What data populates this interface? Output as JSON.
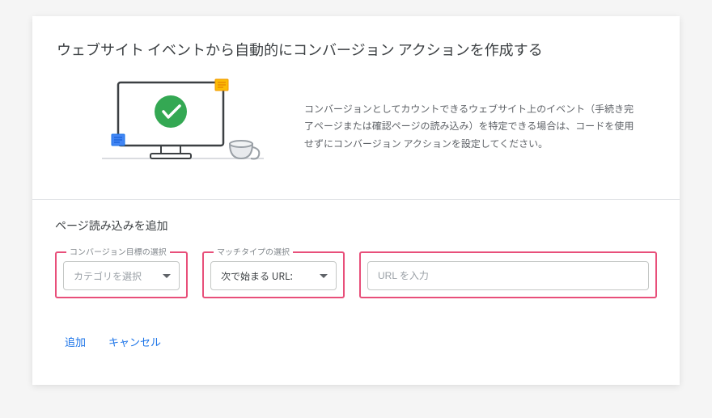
{
  "page": {
    "title": "ウェブサイト イベントから自動的にコンバージョン アクションを作成する",
    "hero_description": "コンバージョンとしてカウントできるウェブサイト上のイベント（手続き完了ページまたは確認ページの読み込み）を特定できる場合は、コードを使用せずにコンバージョン アクションを設定してください。"
  },
  "panel": {
    "title": "ページ読み込みを追加"
  },
  "fields": {
    "goal": {
      "legend": "コンバージョン目標の選択",
      "placeholder": "カテゴリを選択"
    },
    "match": {
      "legend": "マッチタイプの選択",
      "selected": "次で始まる URL:"
    },
    "url": {
      "placeholder": "URL を入力"
    }
  },
  "actions": {
    "add": "追加",
    "cancel": "キャンセル"
  },
  "colors": {
    "highlight": "#e84f7a",
    "link": "#1a73e8",
    "success": "#34a853"
  }
}
